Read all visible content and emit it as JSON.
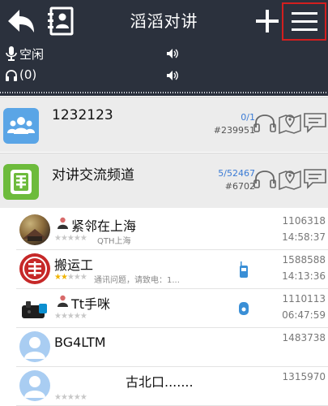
{
  "header": {
    "title": "滔滔对讲"
  },
  "status": {
    "state": "空闲",
    "listeners": "(0)"
  },
  "channels": [
    {
      "name": "1232123",
      "count": "0/1",
      "id": "#239951"
    },
    {
      "name": "对讲交流频道",
      "count": "5/52467",
      "id": "#6702"
    }
  ],
  "contacts": [
    {
      "name": "紧邻在上海",
      "stars_filled": 0,
      "stars_total": 5,
      "note": "QTH上海",
      "id": "1106318",
      "time": "14:58:37"
    },
    {
      "name": "搬运工",
      "stars_filled": 2,
      "stars_total": 5,
      "note": "通讯问题，请致电：1...",
      "id": "1588588",
      "time": "14:13:36"
    },
    {
      "name": "Tt手咪",
      "stars_filled": 0,
      "stars_total": 5,
      "note": "",
      "id": "1110113",
      "time": "06:47:59"
    },
    {
      "name": "BG4LTM",
      "stars_filled": 0,
      "stars_total": 0,
      "note": "",
      "id": "1483738",
      "time": ""
    },
    {
      "name": "古北口.......",
      "stars_filled": 0,
      "stars_total": 5,
      "note": "",
      "id": "1315970",
      "time": ""
    }
  ],
  "icons": {
    "back": "back-arrow-icon",
    "contacts": "contacts-book-icon",
    "add": "plus-icon",
    "menu": "hamburger-menu-icon",
    "mic": "microphone-icon",
    "headphones": "headphones-icon",
    "volume": "speaker-icon",
    "channel_listen": "headphones-icon",
    "channel_map": "map-pin-icon",
    "channel_chat": "chat-bubble-icon"
  },
  "colors": {
    "header_bg": "#2b313d",
    "menu_highlight": "#d31f1f",
    "channel_bg": "#ececec",
    "accent_blue": "#3a7bd5",
    "star_on": "#f0b400"
  }
}
